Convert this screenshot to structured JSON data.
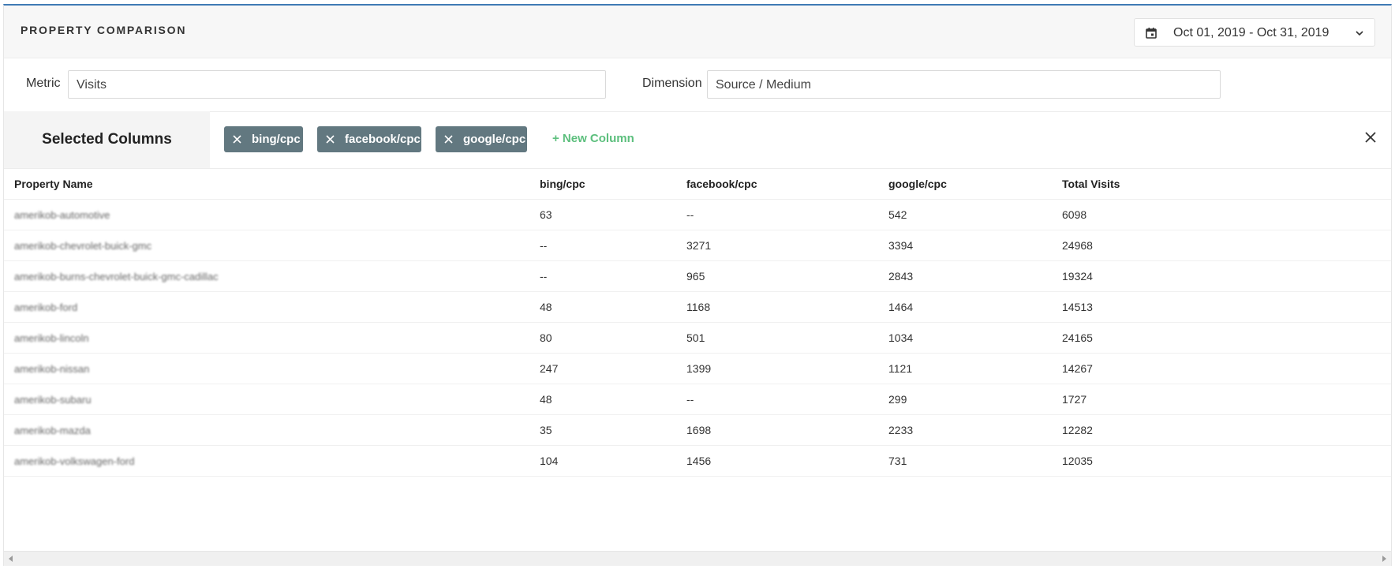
{
  "header": {
    "title": "PROPERTY COMPARISON",
    "date_range": "Oct 01, 2019 - Oct 31, 2019",
    "calendar_icon": "calendar-icon",
    "chevron_icon": "chevron-down-icon"
  },
  "filters": {
    "metric_label": "Metric",
    "metric_value": "Visits",
    "dimension_label": "Dimension",
    "dimension_value": "Source / Medium"
  },
  "selected_columns": {
    "label": "Selected Columns",
    "chips": [
      "bing/cpc",
      "facebook/cpc",
      "google/cpc"
    ],
    "new_column_label": "+ New Column",
    "chip_color": "#627880",
    "accent_color": "#5cbf7d"
  },
  "table": {
    "headers": [
      "Property Name",
      "bing/cpc",
      "facebook/cpc",
      "google/cpc",
      "Total Visits"
    ],
    "rows": [
      [
        "amerikob-automotive",
        "63",
        "--",
        "542",
        "6098"
      ],
      [
        "amerikob-chevrolet-buick-gmc",
        "--",
        "3271",
        "3394",
        "24968"
      ],
      [
        "amerikob-burns-chevrolet-buick-gmc-cadillac",
        "--",
        "965",
        "2843",
        "19324"
      ],
      [
        "amerikob-ford",
        "48",
        "1168",
        "1464",
        "14513"
      ],
      [
        "amerikob-lincoln",
        "80",
        "501",
        "1034",
        "24165"
      ],
      [
        "amerikob-nissan",
        "247",
        "1399",
        "1121",
        "14267"
      ],
      [
        "amerikob-subaru",
        "48",
        "--",
        "299",
        "1727"
      ],
      [
        "amerikob-mazda",
        "35",
        "1698",
        "2233",
        "12282"
      ],
      [
        "amerikob-volkswagen-ford",
        "104",
        "1456",
        "731",
        "12035"
      ]
    ]
  }
}
